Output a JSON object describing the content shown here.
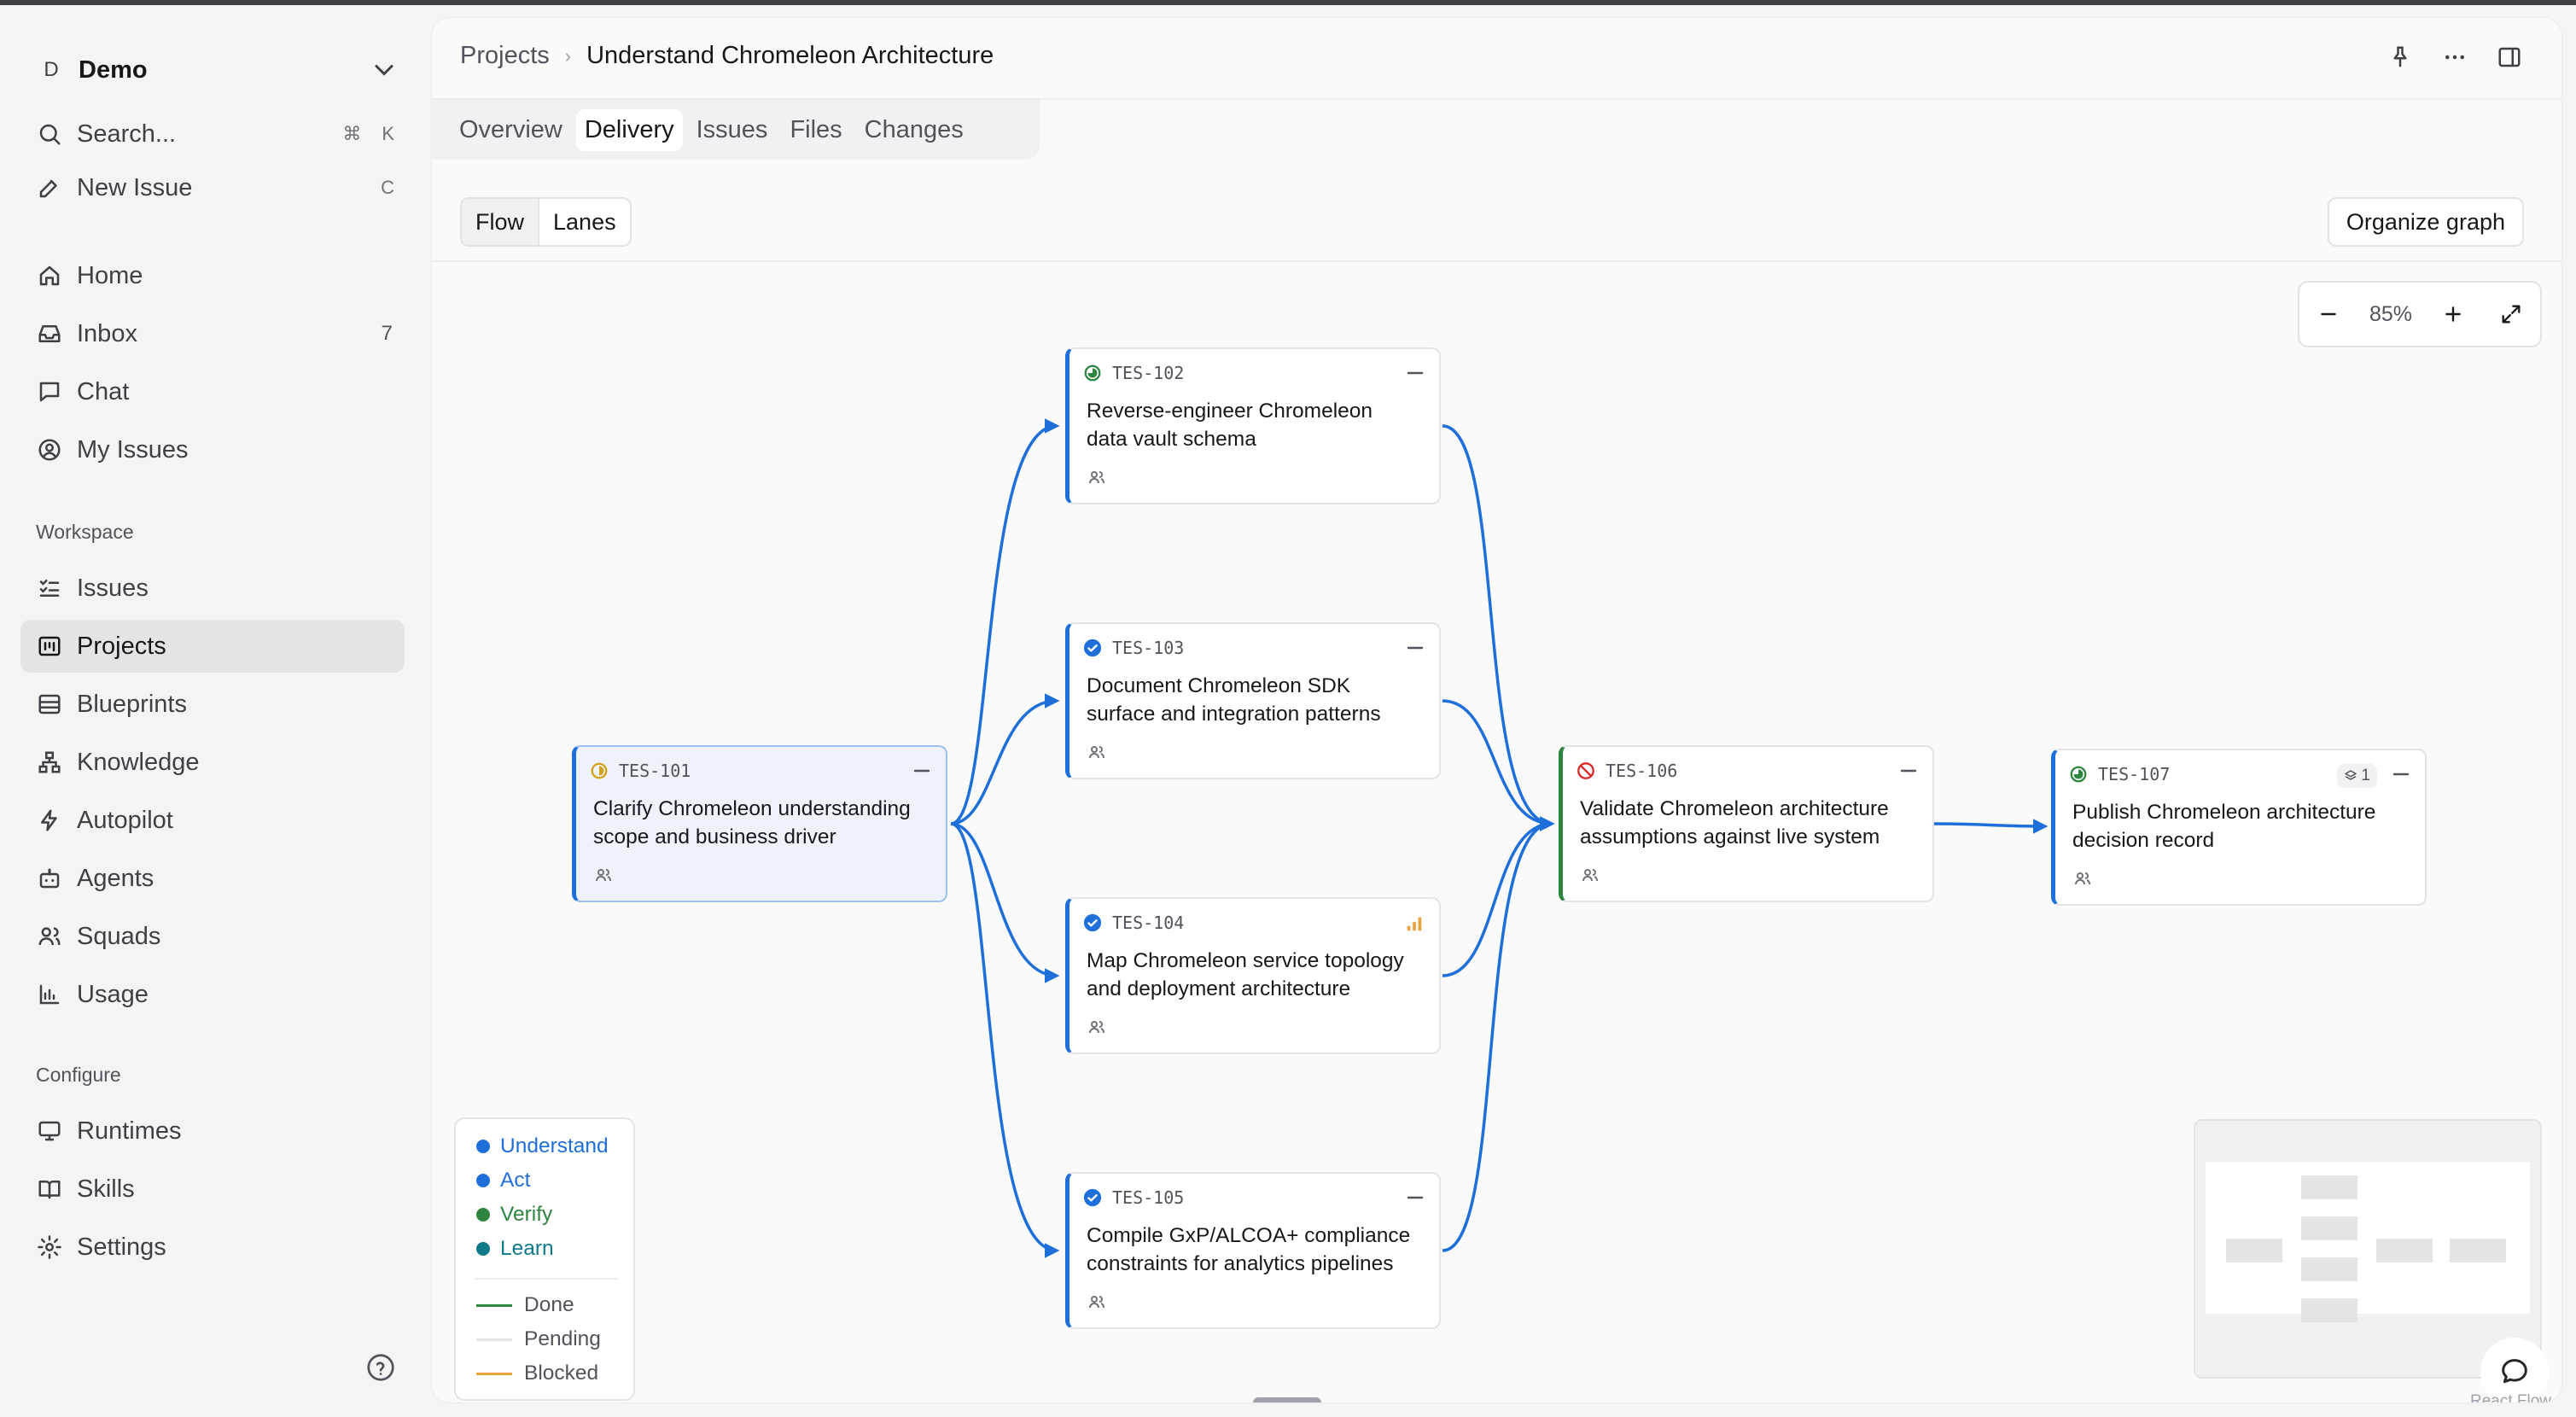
{
  "sidebar": {
    "workspace": {
      "badge": "D",
      "name": "Demo"
    },
    "search": {
      "label": "Search...",
      "kbd1": "⌘",
      "kbd2": "K"
    },
    "new_issue": {
      "label": "New Issue",
      "kbd": "C"
    },
    "items": [
      {
        "label": "Home",
        "icon": "home-icon"
      },
      {
        "label": "Inbox",
        "icon": "inbox-icon",
        "count": "7"
      },
      {
        "label": "Chat",
        "icon": "chat-icon"
      },
      {
        "label": "My Issues",
        "icon": "user-circle-icon"
      }
    ],
    "workspace_section": "Workspace",
    "workspace_items": [
      {
        "label": "Issues",
        "icon": "list-icon"
      },
      {
        "label": "Projects",
        "icon": "project-icon",
        "active": true
      },
      {
        "label": "Blueprints",
        "icon": "blueprint-icon"
      },
      {
        "label": "Knowledge",
        "icon": "knowledge-icon"
      },
      {
        "label": "Autopilot",
        "icon": "bolt-icon"
      },
      {
        "label": "Agents",
        "icon": "bot-icon"
      },
      {
        "label": "Squads",
        "icon": "users-icon"
      },
      {
        "label": "Usage",
        "icon": "bar-chart-icon"
      }
    ],
    "configure_section": "Configure",
    "configure_items": [
      {
        "label": "Runtimes",
        "icon": "monitor-icon"
      },
      {
        "label": "Skills",
        "icon": "book-icon"
      },
      {
        "label": "Settings",
        "icon": "gear-icon"
      }
    ]
  },
  "header": {
    "breadcrumb_parent": "Projects",
    "breadcrumb_current": "Understand Chromeleon Architecture"
  },
  "tabs": [
    "Overview",
    "Delivery",
    "Issues",
    "Files",
    "Changes"
  ],
  "active_tab": "Delivery",
  "toolbar": {
    "view_flow": "Flow",
    "view_lanes": "Lanes",
    "organize": "Organize graph"
  },
  "zoom": {
    "value": "85%"
  },
  "nodes": [
    {
      "id": "TES-101",
      "title_1": "Clarify Chromeleon understanding",
      "title_2": "scope and business driver",
      "status": "in-progress"
    },
    {
      "id": "TES-102",
      "title_1": "Reverse-engineer Chromeleon",
      "title_2": "data vault schema",
      "status": "in-review"
    },
    {
      "id": "TES-103",
      "title_1": "Document Chromeleon SDK",
      "title_2": "surface and integration patterns",
      "status": "done"
    },
    {
      "id": "TES-104",
      "title_1": "Map Chromeleon service topology",
      "title_2": "and deployment architecture",
      "status": "done",
      "priority": "high"
    },
    {
      "id": "TES-105",
      "title_1": "Compile GxP/ALCOA+ compliance",
      "title_2": "constraints for analytics pipelines",
      "status": "done"
    },
    {
      "id": "TES-106",
      "title_1": "Validate Chromeleon architecture",
      "title_2": "assumptions against live system",
      "status": "blocked"
    },
    {
      "id": "TES-107",
      "title_1": "Publish Chromeleon architecture",
      "title_2": "decision record",
      "status": "in-review",
      "subissues": "1"
    }
  ],
  "legend": {
    "phases": [
      {
        "label": "Understand",
        "color": "#1e6fd9"
      },
      {
        "label": "Act",
        "color": "#1e6fd9"
      },
      {
        "label": "Verify",
        "color": "#2e8540"
      },
      {
        "label": "Learn",
        "color": "#0e7a8a"
      }
    ],
    "edges": [
      {
        "label": "Done",
        "color": "#2e8540"
      },
      {
        "label": "Pending",
        "color": "#e4e4e7"
      },
      {
        "label": "Blocked",
        "color": "#e8a33c"
      }
    ]
  },
  "attribution": "React Flow",
  "colors": {
    "accent": "#1e6fd9",
    "verify": "#2e8540",
    "learn": "#0e7a8a",
    "blocked": "#dc2626",
    "priority": "#e8a33c"
  }
}
